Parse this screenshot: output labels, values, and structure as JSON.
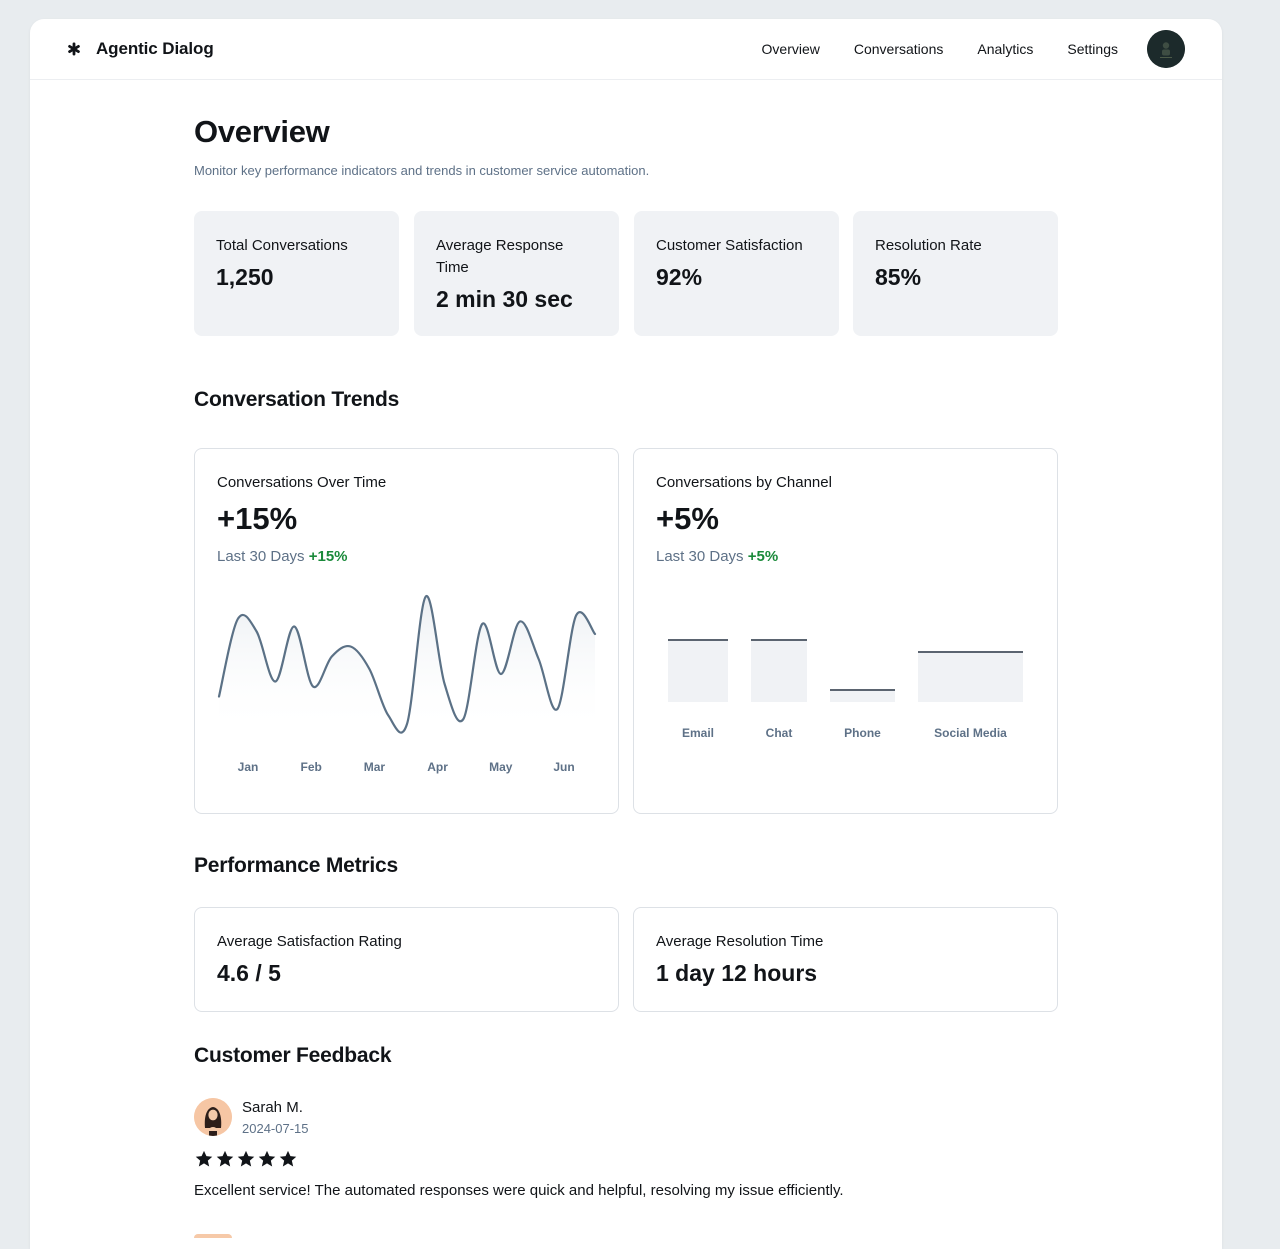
{
  "app": {
    "name": "Agentic Dialog",
    "logo_icon": "asterisk-icon"
  },
  "nav": {
    "items": [
      {
        "label": "Overview"
      },
      {
        "label": "Conversations"
      },
      {
        "label": "Analytics"
      },
      {
        "label": "Settings"
      }
    ],
    "avatar_icon": "user-avatar-icon"
  },
  "header": {
    "title": "Overview",
    "subtitle": "Monitor key performance indicators and trends in customer service automation."
  },
  "stats": [
    {
      "label": "Total Conversations",
      "value": "1,250"
    },
    {
      "label": "Average Response Time",
      "value": "2 min 30 sec"
    },
    {
      "label": "Customer Satisfaction",
      "value": "92%"
    },
    {
      "label": "Resolution Rate",
      "value": "85%"
    }
  ],
  "trends": {
    "title": "Conversation Trends",
    "over_time": {
      "title": "Conversations Over Time",
      "big": "+15%",
      "period": "Last 30 Days",
      "change": "+15%"
    },
    "by_channel": {
      "title": "Conversations by Channel",
      "big": "+5%",
      "period": "Last 30 Days",
      "change": "+5%"
    }
  },
  "chart_data": [
    {
      "type": "line",
      "categories": [
        "Jan",
        "Feb",
        "Mar",
        "Apr",
        "May",
        "Jun"
      ],
      "x": [
        0,
        0.05,
        0.1,
        0.15,
        0.2,
        0.25,
        0.3,
        0.35,
        0.4,
        0.45,
        0.5,
        0.55,
        0.6,
        0.65,
        0.7,
        0.75,
        0.8,
        0.85,
        0.9,
        0.95,
        1
      ],
      "y": [
        30,
        92,
        82,
        42,
        86,
        38,
        62,
        70,
        52,
        15,
        8,
        110,
        40,
        12,
        88,
        48,
        90,
        60,
        20,
        95,
        80
      ],
      "ylim": [
        0,
        120
      ],
      "line_color": "#5b7186",
      "xlabel": "",
      "ylabel": "",
      "title": ""
    },
    {
      "type": "bar",
      "categories": [
        "Email",
        "Chat",
        "Phone",
        "Social Media"
      ],
      "values": [
        62,
        62,
        12,
        50
      ],
      "ylim": [
        0,
        100
      ],
      "bar_color": "#f0f2f5",
      "top_color": "#5b6470",
      "xlabel": "",
      "ylabel": "",
      "title": ""
    }
  ],
  "performance": {
    "title": "Performance Metrics",
    "metrics": [
      {
        "label": "Average Satisfaction Rating",
        "value": "4.6 / 5"
      },
      {
        "label": "Average Resolution Time",
        "value": "1 day 12 hours"
      }
    ]
  },
  "feedback": {
    "title": "Customer Feedback",
    "items": [
      {
        "name": "Sarah M.",
        "date": "2024-07-15",
        "rating": 5,
        "text": "Excellent service! The automated responses were quick and helpful, resolving my issue efficiently."
      }
    ]
  }
}
